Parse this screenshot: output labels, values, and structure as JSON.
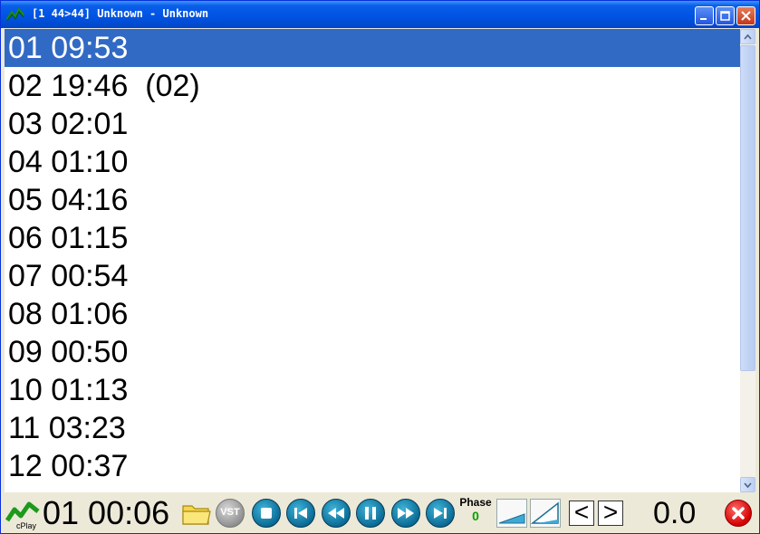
{
  "window": {
    "title": "[1 44>44] Unknown - Unknown"
  },
  "tracks": [
    {
      "label": "01 09:53",
      "selected": true
    },
    {
      "label": "02 19:46  (02)",
      "selected": false
    },
    {
      "label": "03 02:01",
      "selected": false
    },
    {
      "label": "04 01:10",
      "selected": false
    },
    {
      "label": "05 04:16",
      "selected": false
    },
    {
      "label": "06 01:15",
      "selected": false
    },
    {
      "label": "07 00:54",
      "selected": false
    },
    {
      "label": "08 01:06",
      "selected": false
    },
    {
      "label": "09 00:50",
      "selected": false
    },
    {
      "label": "10 01:13",
      "selected": false
    },
    {
      "label": "11 03:23",
      "selected": false
    },
    {
      "label": "12 00:37",
      "selected": false
    }
  ],
  "toolbar": {
    "logo_label": "cPlay",
    "position": "01 00:06",
    "vst_label": "VST",
    "phase_label": "Phase",
    "phase_value": "0",
    "prev_label": "<",
    "next_label": ">",
    "gain_value": "0.0"
  },
  "icons": {
    "app": "cplay-logo-icon",
    "open": "folder-icon",
    "stop": "stop-icon",
    "previous": "skip-back-icon",
    "rewind": "rewind-icon",
    "pause": "pause-icon",
    "forward": "fast-forward-icon",
    "next": "skip-forward-icon",
    "close": "close-icon"
  },
  "colors": {
    "titlebar": "#0054e3",
    "selection": "#316ac5",
    "transport_button": "#0b6c96",
    "close_button": "#e01010",
    "phase_value": "#08a000"
  }
}
